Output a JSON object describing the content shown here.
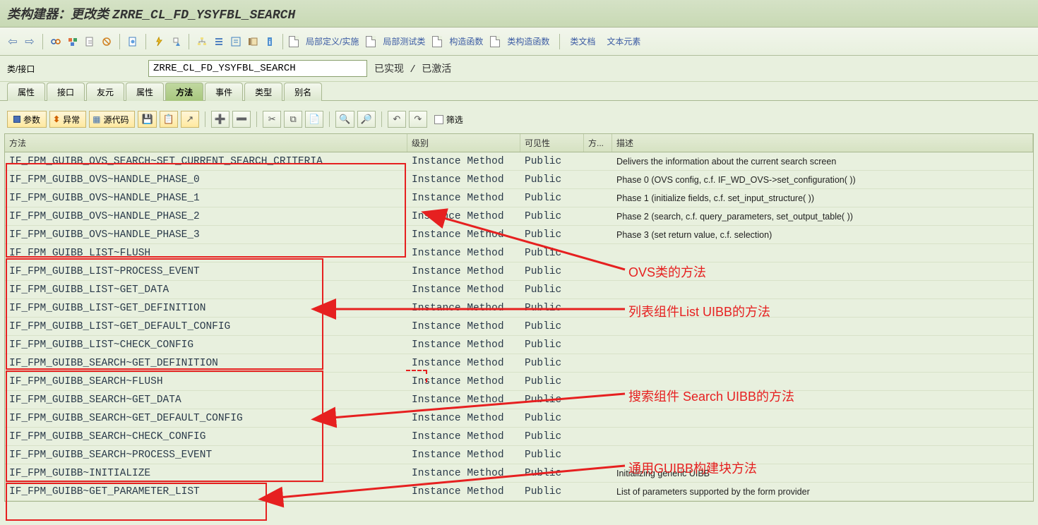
{
  "title": {
    "prefix": "类构建器：更改类 ",
    "class_name": "ZRRE_CL_FD_YSYFBL_SEARCH"
  },
  "toolbar_links": {
    "local_def": "局部定义/实施",
    "local_test": "局部测试类",
    "constructor": "构造函数",
    "class_constructor": "类构造函数",
    "class_doc": "类文档",
    "text_elements": "文本元素"
  },
  "info": {
    "label": "类/接口",
    "value": "ZRRE_CL_FD_YSYFBL_SEARCH",
    "status": "已实现 / 已激活"
  },
  "tabs": [
    "属性",
    "接口",
    "友元",
    "属性",
    "方法",
    "事件",
    "类型",
    "别名"
  ],
  "active_tab_index": 4,
  "action_buttons": {
    "params": "参数",
    "exceptions": "异常",
    "source": "源代码",
    "filter": "筛选"
  },
  "grid_headers": {
    "method": "方法",
    "level": "级别",
    "visibility": "可见性",
    "fang": "方...",
    "desc": "描述"
  },
  "rows": [
    {
      "method": "IF_FPM_GUIBB_OVS_SEARCH~SET_CURRENT_SEARCH_CRITERIA",
      "level": "Instance Method",
      "vis": "Public",
      "desc": "Delivers the information about the current search screen"
    },
    {
      "method": "IF_FPM_GUIBB_OVS~HANDLE_PHASE_0",
      "level": "Instance Method",
      "vis": "Public",
      "desc": "Phase 0 (OVS config, c.f. IF_WD_OVS->set_configuration( ))"
    },
    {
      "method": "IF_FPM_GUIBB_OVS~HANDLE_PHASE_1",
      "level": "Instance Method",
      "vis": "Public",
      "desc": "Phase 1 (initialize fields, c.f. set_input_structure( ))"
    },
    {
      "method": "IF_FPM_GUIBB_OVS~HANDLE_PHASE_2",
      "level": "Instance Method",
      "vis": "Public",
      "desc": "Phase 2 (search, c.f. query_parameters, set_output_table( ))"
    },
    {
      "method": "IF_FPM_GUIBB_OVS~HANDLE_PHASE_3",
      "level": "Instance Method",
      "vis": "Public",
      "desc": "Phase 3 (set return value, c.f. selection)"
    },
    {
      "method": "IF_FPM_GUIBB_LIST~FLUSH",
      "level": "Instance Method",
      "vis": "Public",
      "desc": ""
    },
    {
      "method": "IF_FPM_GUIBB_LIST~PROCESS_EVENT",
      "level": "Instance Method",
      "vis": "Public",
      "desc": ""
    },
    {
      "method": "IF_FPM_GUIBB_LIST~GET_DATA",
      "level": "Instance Method",
      "vis": "Public",
      "desc": ""
    },
    {
      "method": "IF_FPM_GUIBB_LIST~GET_DEFINITION",
      "level": "Instance Method",
      "vis": "Public",
      "desc": ""
    },
    {
      "method": "IF_FPM_GUIBB_LIST~GET_DEFAULT_CONFIG",
      "level": "Instance Method",
      "vis": "Public",
      "desc": ""
    },
    {
      "method": "IF_FPM_GUIBB_LIST~CHECK_CONFIG",
      "level": "Instance Method",
      "vis": "Public",
      "desc": ""
    },
    {
      "method": "IF_FPM_GUIBB_SEARCH~GET_DEFINITION",
      "level": "Instance Method",
      "vis": "Public",
      "desc": ""
    },
    {
      "method": "IF_FPM_GUIBB_SEARCH~FLUSH",
      "level": "Instance Method",
      "vis": "Public",
      "desc": ""
    },
    {
      "method": "IF_FPM_GUIBB_SEARCH~GET_DATA",
      "level": "Instance Method",
      "vis": "Public",
      "desc": ""
    },
    {
      "method": "IF_FPM_GUIBB_SEARCH~GET_DEFAULT_CONFIG",
      "level": "Instance Method",
      "vis": "Public",
      "desc": ""
    },
    {
      "method": "IF_FPM_GUIBB_SEARCH~CHECK_CONFIG",
      "level": "Instance Method",
      "vis": "Public",
      "desc": ""
    },
    {
      "method": "IF_FPM_GUIBB_SEARCH~PROCESS_EVENT",
      "level": "Instance Method",
      "vis": "Public",
      "desc": ""
    },
    {
      "method": "IF_FPM_GUIBB~INITIALIZE",
      "level": "Instance Method",
      "vis": "Public",
      "desc": "Initializing generic UIBB"
    },
    {
      "method": "IF_FPM_GUIBB~GET_PARAMETER_LIST",
      "level": "Instance Method",
      "vis": "Public",
      "desc": "List of parameters supported by the form provider"
    }
  ],
  "annotations": {
    "ovs": "OVS类的方法",
    "list": "列表组件List UIBB的方法",
    "search": "搜索组件 Search UIBB的方法",
    "guibb": "通用GUIBB构建块方法"
  }
}
